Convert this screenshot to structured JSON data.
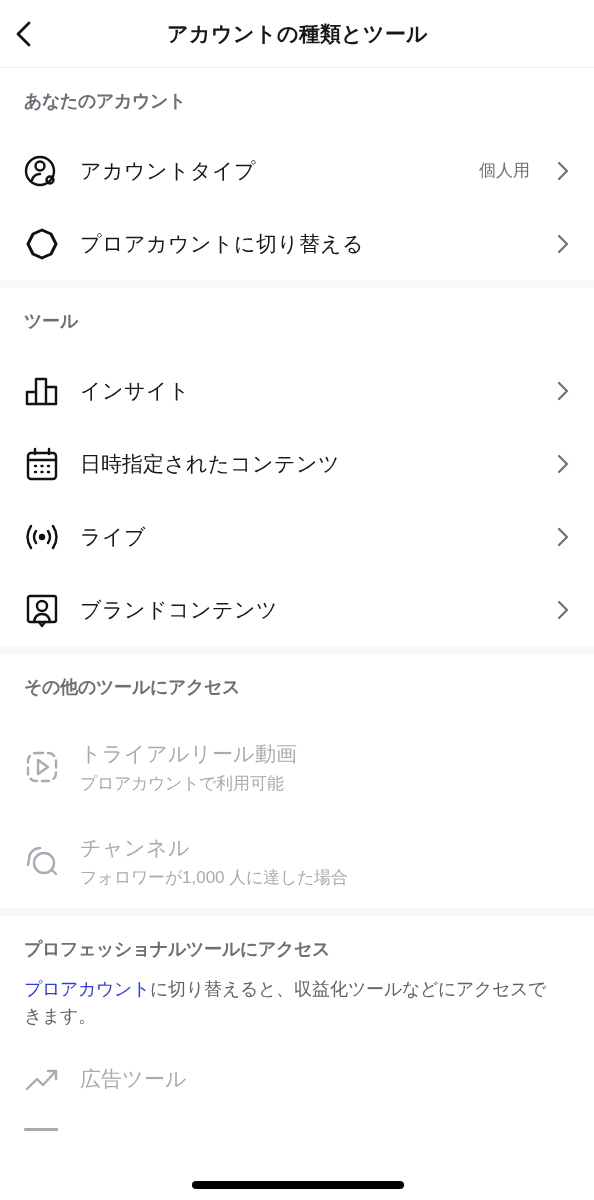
{
  "header": {
    "title": "アカウントの種類とツール"
  },
  "sections": [
    {
      "title": "あなたのアカウント",
      "items": [
        {
          "label": "アカウントタイプ",
          "value": "個人用",
          "disabled": false
        },
        {
          "label": "プロアカウントに切り替える",
          "disabled": false
        }
      ]
    },
    {
      "title": "ツール",
      "items": [
        {
          "label": "インサイト",
          "disabled": false
        },
        {
          "label": "日時指定されたコンテンツ",
          "disabled": false
        },
        {
          "label": "ライブ",
          "disabled": false
        },
        {
          "label": "ブランドコンテンツ",
          "disabled": false
        }
      ]
    },
    {
      "title": "その他のツールにアクセス",
      "items": [
        {
          "label": "トライアルリール動画",
          "sublabel": "プロアカウントで利用可能",
          "disabled": true
        },
        {
          "label": "チャンネル",
          "sublabel": "フォロワーが1,000 人に達した場合",
          "disabled": true
        }
      ]
    },
    {
      "title": "プロフェッショナルツールにアクセス",
      "description": {
        "link": "プロアカウント",
        "text": "に切り替えると、収益化ツールなどにアクセスできます。"
      },
      "items": [
        {
          "label": "広告ツール",
          "disabled": true
        }
      ]
    }
  ]
}
